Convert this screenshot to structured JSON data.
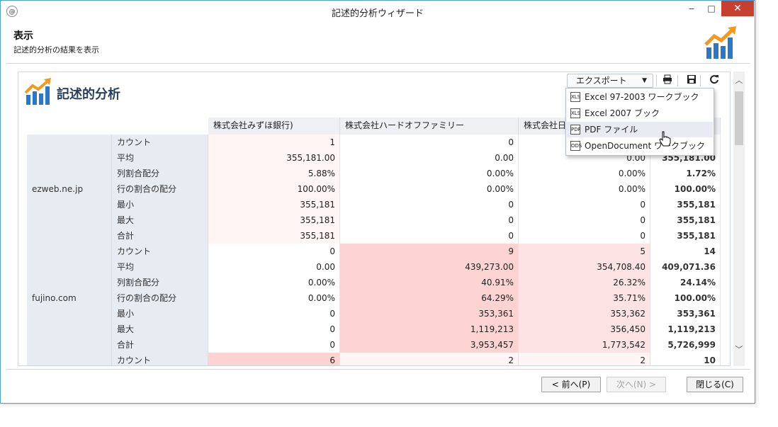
{
  "window": {
    "title": "記述的分析ウィザード",
    "icon_label": "@",
    "controls": {
      "minimize": "‒",
      "maximize": "□",
      "close": "✕"
    }
  },
  "header": {
    "title": "表示",
    "subtitle": "記述的分析の結果を表示"
  },
  "panel": {
    "title": "記述的分析",
    "export_label": "エクスポート",
    "toolbar_icons": [
      "print-icon",
      "save-icon",
      "refresh-icon"
    ]
  },
  "export_menu": {
    "items": [
      {
        "label": "Excel 97-2003 ワークブック",
        "icon": "excel-icon",
        "badge": "XLS"
      },
      {
        "label": "Excel 2007 ブック",
        "icon": "excel-icon",
        "badge": "XLS"
      },
      {
        "label": "PDF ファイル",
        "icon": "pdf-icon",
        "badge": "PDF",
        "highlighted": true
      },
      {
        "label": "OpenDocument ワークブック",
        "icon": "ods-icon",
        "badge": "ODS"
      }
    ]
  },
  "table": {
    "columns": [
      "株式会社みずほ銀行)",
      "株式会社ハードオフファミリー",
      "株式会社日",
      ""
    ],
    "measures": [
      "カウント",
      "平均",
      "列割合配分",
      "行の割合の配分",
      "最小",
      "最大",
      "合計"
    ],
    "groups": [
      {
        "name": "ezweb.ne.jp",
        "rows": [
          [
            "1",
            "0",
            "",
            ""
          ],
          [
            "355,181.00",
            "0.00",
            "0.00",
            "355,181.00"
          ],
          [
            "5.88%",
            "0.00%",
            "0.00%",
            "1.72%"
          ],
          [
            "100.00%",
            "0.00%",
            "0.00%",
            "100.00%"
          ],
          [
            "355,181",
            "0",
            "0",
            "355,181"
          ],
          [
            "355,181",
            "0",
            "0",
            "355,181"
          ],
          [
            "355,181",
            "0",
            "0",
            "355,181"
          ]
        ]
      },
      {
        "name": "fujino.com",
        "rows": [
          [
            "0",
            "9",
            "5",
            "14"
          ],
          [
            "0.00",
            "439,273.00",
            "354,708.40",
            "409,071.36"
          ],
          [
            "0.00%",
            "40.91%",
            "26.32%",
            "24.14%"
          ],
          [
            "0.00%",
            "64.29%",
            "35.71%",
            "100.00%"
          ],
          [
            "0",
            "353,361",
            "353,362",
            "353,361"
          ],
          [
            "0",
            "1,119,213",
            "356,450",
            "1,119,213"
          ],
          [
            "0",
            "3,953,457",
            "1,773,542",
            "5,726,999"
          ]
        ]
      },
      {
        "name": "",
        "rows": [
          [
            "6",
            "2",
            "2",
            "10"
          ]
        ]
      }
    ]
  },
  "colors": {
    "cell_light": "#fff5f5",
    "cell_pink_light": "#fde3e3",
    "cell_pink": "#fdd3d3",
    "cell_white": "#ffffff",
    "header_bg": "#eef0f4",
    "accent_orange": "#f29a1f",
    "accent_blue": "#2a78c8"
  },
  "footer": {
    "prev_label": "< 前へ(P)",
    "next_label": "次へ(N) >",
    "close_label": "閉じる(C)"
  }
}
